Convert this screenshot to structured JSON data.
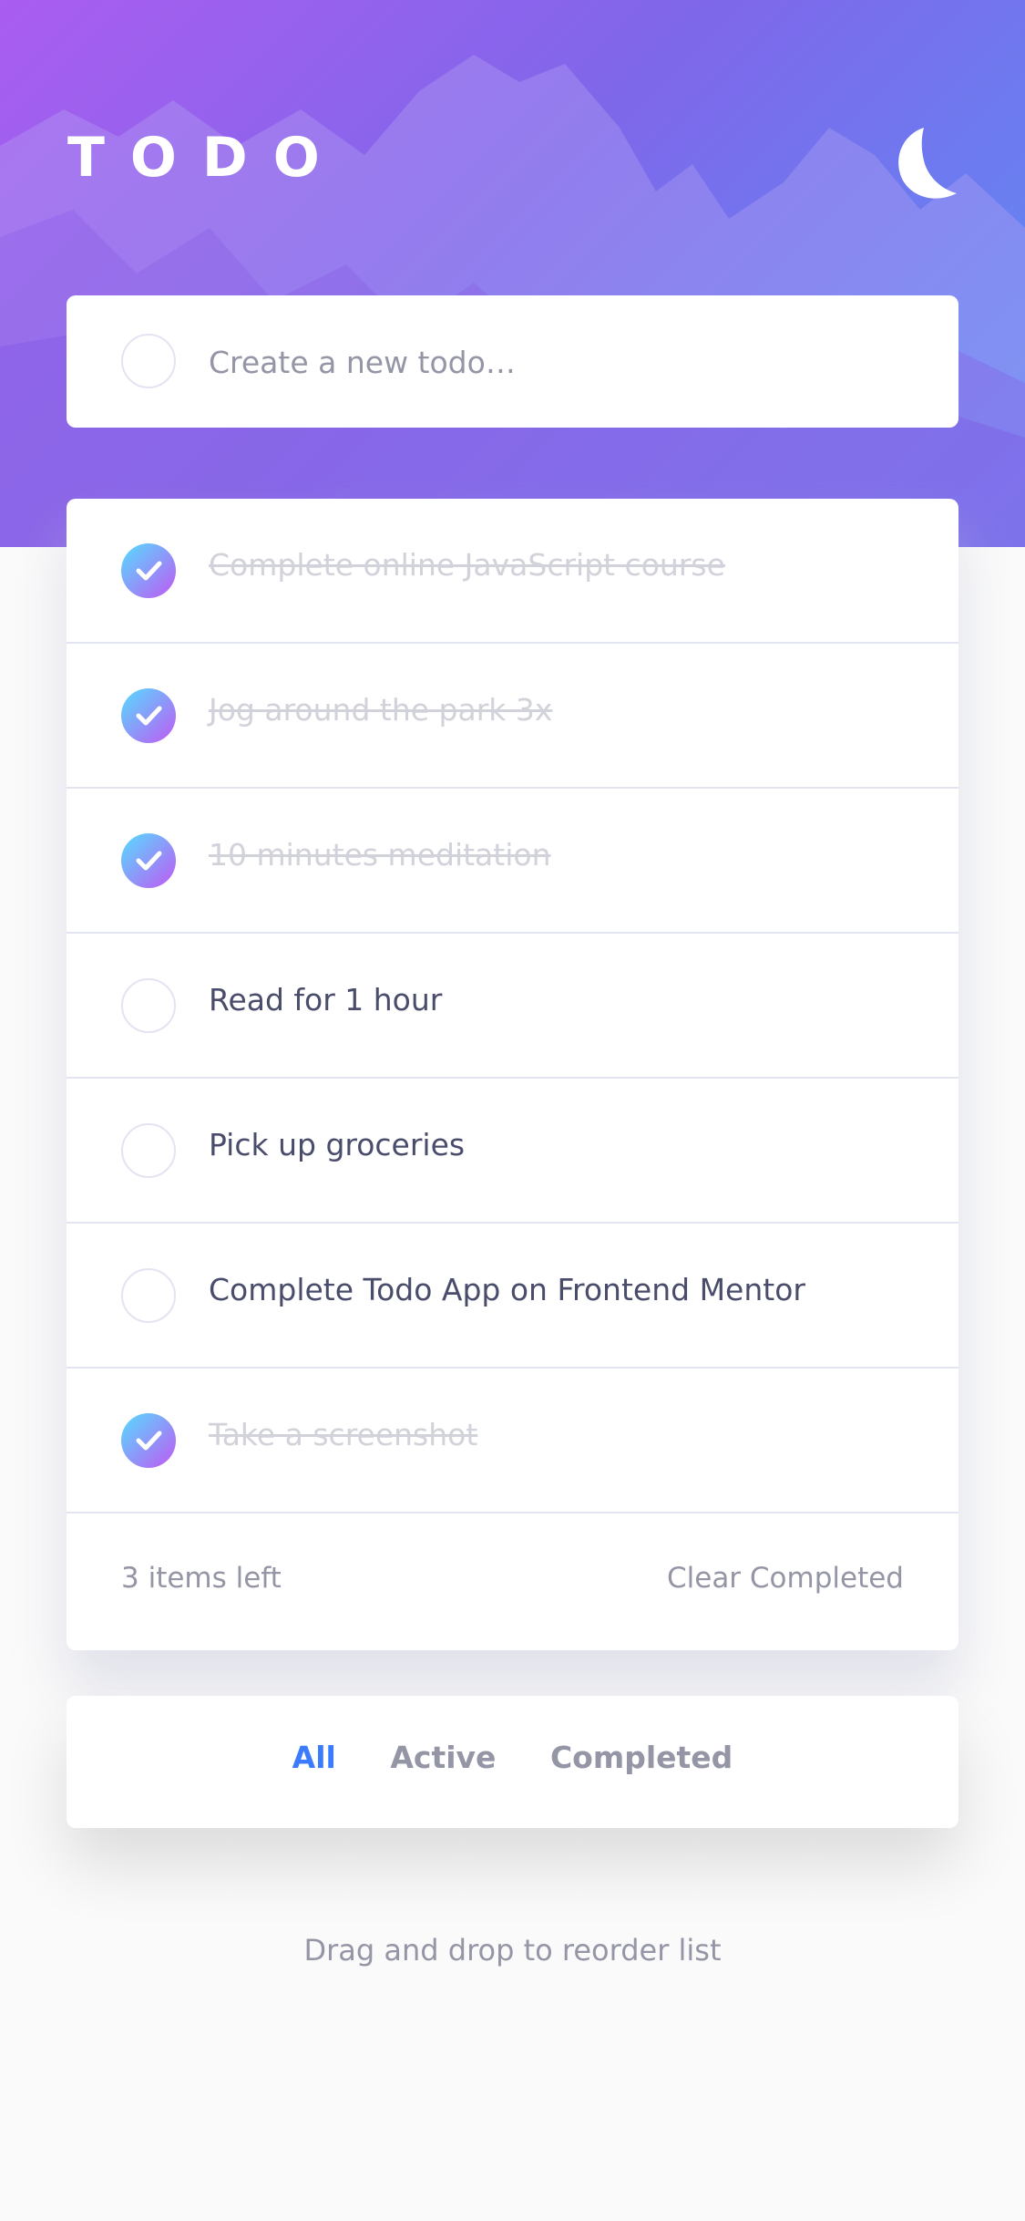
{
  "header": {
    "title": "TODO",
    "theme_icon": "moon-icon"
  },
  "new_todo": {
    "placeholder": "Create a new todo…",
    "value": ""
  },
  "todos": [
    {
      "text": "Complete online JavaScript course",
      "completed": true
    },
    {
      "text": "Jog around the park 3x",
      "completed": true
    },
    {
      "text": "10 minutes meditation",
      "completed": true
    },
    {
      "text": "Read for 1 hour",
      "completed": false
    },
    {
      "text": "Pick up groceries",
      "completed": false
    },
    {
      "text": "Complete Todo App on Frontend Mentor",
      "completed": false
    },
    {
      "text": "Take a screenshot",
      "completed": true
    }
  ],
  "footer": {
    "items_left": "3 items left",
    "clear_completed": "Clear Completed"
  },
  "filters": {
    "all": "All",
    "active": "Active",
    "completed": "Completed",
    "selected": "All"
  },
  "hint": "Drag and drop to reorder list",
  "colors": {
    "accent": "#3a7cfd",
    "check_gradient_start": "#55ddff",
    "check_gradient_end": "#c058f3",
    "hero_gradient_start": "#aa5df0",
    "hero_gradient_end": "#5b8ff5",
    "completed_text": "#d1d2da",
    "active_text": "#494c6b",
    "muted_text": "#9495a5"
  }
}
